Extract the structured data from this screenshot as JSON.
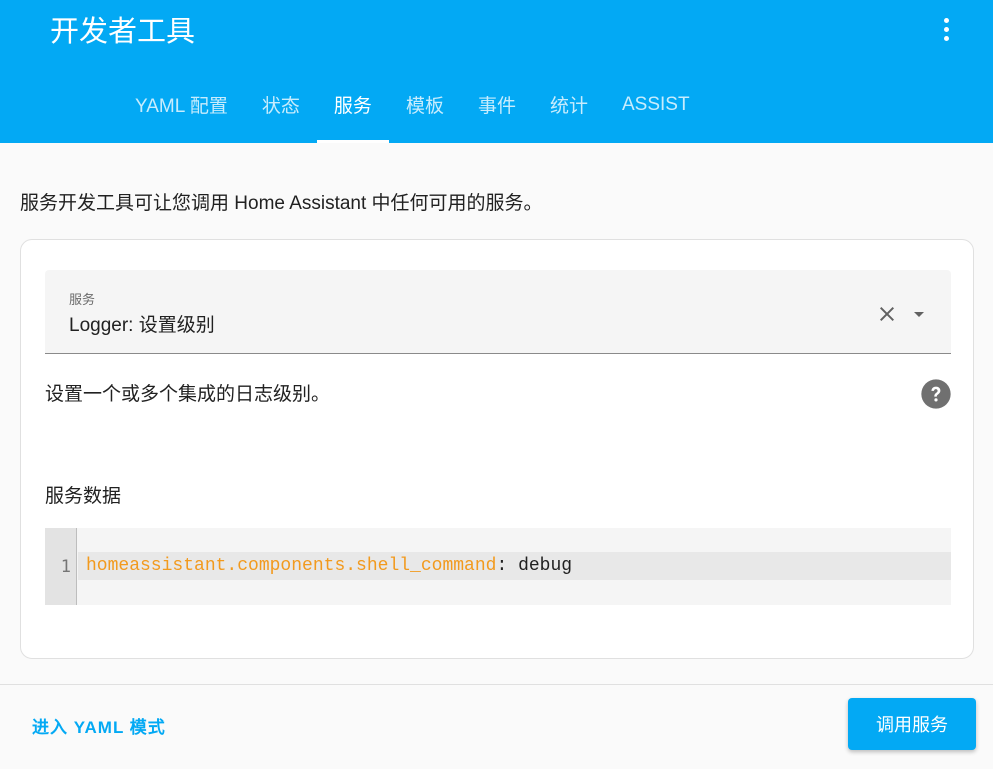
{
  "colors": {
    "primary": "#03a9f4",
    "code_key": "#f29a1e",
    "background": "#fafafa"
  },
  "header": {
    "title": "开发者工具",
    "menu_icon": "dots-vertical-icon",
    "tabs": [
      {
        "label": "YAML 配置",
        "active": false
      },
      {
        "label": "状态",
        "active": false
      },
      {
        "label": "服务",
        "active": true
      },
      {
        "label": "模板",
        "active": false
      },
      {
        "label": "事件",
        "active": false
      },
      {
        "label": "统计",
        "active": false
      },
      {
        "label": "ASSIST",
        "active": false
      }
    ]
  },
  "main": {
    "description": "服务开发工具可让您调用 Home Assistant 中任何可用的服务。",
    "service_select": {
      "label": "服务",
      "value": "Logger: 设置级别",
      "clear_icon": "close-icon",
      "dropdown_icon": "menu-down-icon"
    },
    "service_description": "设置一个或多个集成的日志级别。",
    "help_icon": "help-circle-icon",
    "service_data_label": "服务数据",
    "editor": {
      "line_number": "1",
      "key": "homeassistant.components.shell_command",
      "separator": ": ",
      "value": "debug"
    }
  },
  "footer": {
    "yaml_mode_link": "进入 YAML 模式",
    "call_service_button": "调用服务"
  }
}
